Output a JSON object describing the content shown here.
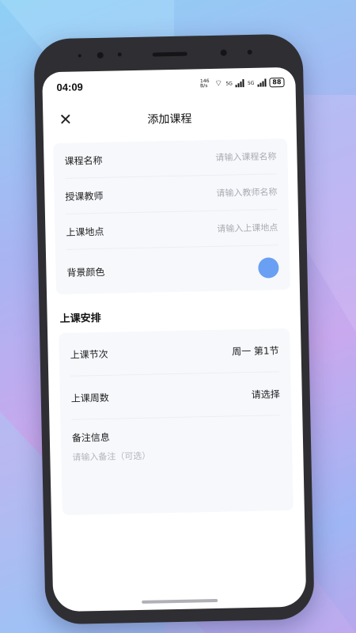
{
  "status": {
    "time": "04:09",
    "network_speed": "146 B/s",
    "sig1": "5G",
    "sig2": "5G",
    "battery": "88"
  },
  "header": {
    "title": "添加课程"
  },
  "form": {
    "course_name": {
      "label": "课程名称",
      "placeholder": "请输入课程名称"
    },
    "teacher": {
      "label": "授课教师",
      "placeholder": "请输入教师名称"
    },
    "location": {
      "label": "上课地点",
      "placeholder": "请输入上课地点"
    },
    "bg_color": {
      "label": "背景颜色",
      "color": "#6aa0f3"
    }
  },
  "schedule": {
    "section_title": "上课安排",
    "period": {
      "label": "上课节次",
      "value": "周一 第1节"
    },
    "weeks": {
      "label": "上课周数",
      "value": "请选择"
    },
    "notes": {
      "label": "备注信息",
      "placeholder": "请输入备注（可选）"
    }
  }
}
